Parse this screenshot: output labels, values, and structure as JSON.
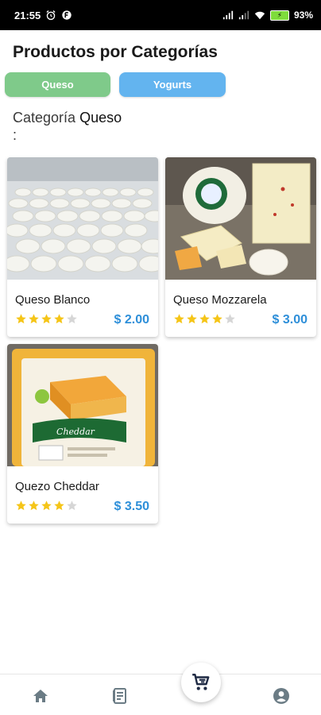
{
  "status_bar": {
    "time": "21:55",
    "battery_level": "93",
    "battery_suffix": "%"
  },
  "page_title": "Productos por Categorías",
  "category_chips": [
    {
      "label": "Queso",
      "color": "#7fca8a"
    },
    {
      "label": "Yogurts",
      "color": "#63b4ef"
    }
  ],
  "category_heading": {
    "label": "Categoría",
    "value": "Queso",
    "colon": ":"
  },
  "products": [
    {
      "name": "Queso Blanco",
      "price": "$ 2.00",
      "rating": 4,
      "max_rating": 5
    },
    {
      "name": "Queso Mozzarela",
      "price": "$ 3.00",
      "rating": 4,
      "max_rating": 5
    },
    {
      "name": "Quezo Cheddar",
      "price": "$ 3.50",
      "rating": 4,
      "max_rating": 5
    }
  ],
  "bottom_nav": {
    "items": [
      "home-icon",
      "catalog-icon",
      "cart-icon",
      "account-icon"
    ]
  },
  "colors": {
    "accent_price": "#2e8fd9",
    "star_filled": "#f5c518",
    "star_empty": "#d6d6d6",
    "nav_icon": "#6b7c85",
    "cart_icon": "#1f2a44"
  }
}
